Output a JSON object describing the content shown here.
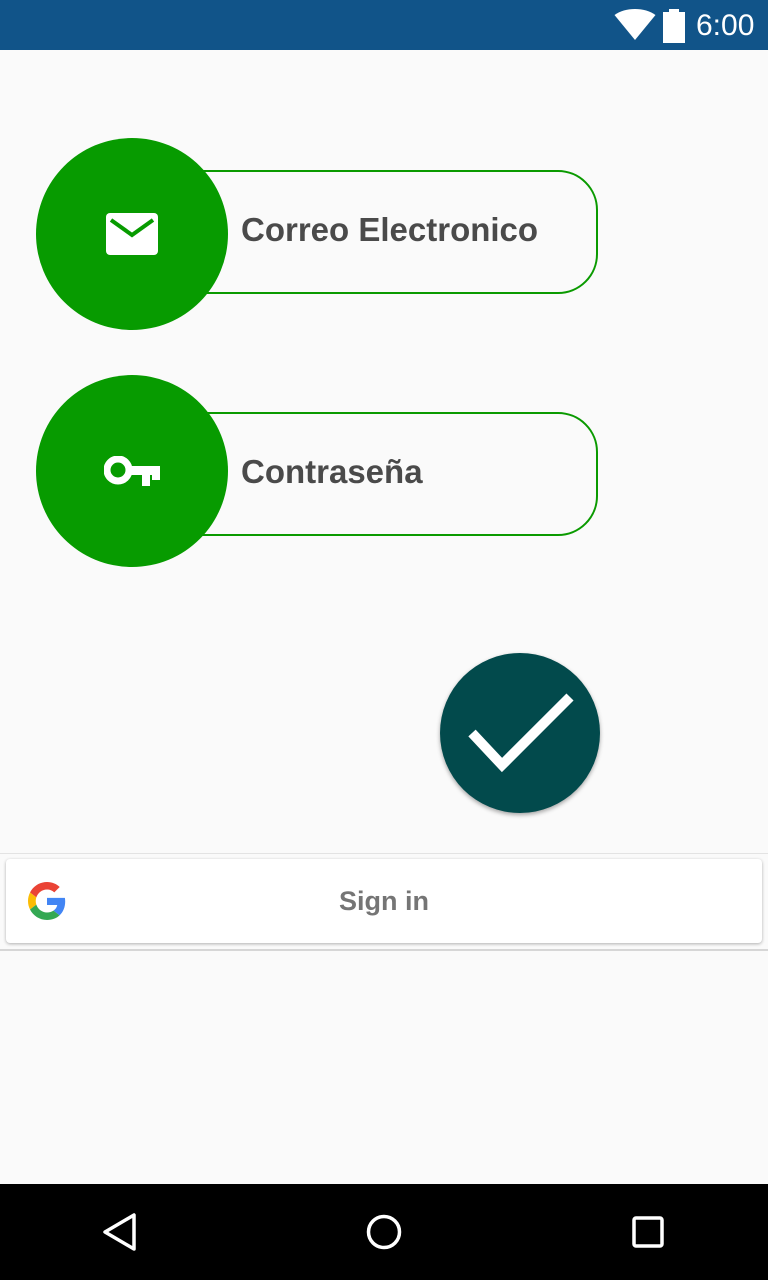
{
  "status_bar": {
    "time": "6:00",
    "background_color": "#115489",
    "icons": [
      "wifi-icon",
      "battery-icon"
    ]
  },
  "form": {
    "email": {
      "label": "Correo Electronico",
      "icon": "email-icon"
    },
    "password": {
      "label": "Contraseña",
      "icon": "key-icon"
    },
    "accent_color": "#079b00",
    "confirm_icon": "checkmark-icon",
    "confirm_color": "#024a4c"
  },
  "google_signin": {
    "label": "Sign in",
    "icon": "google-logo-icon"
  },
  "nav_bar": {
    "icons": [
      "back-icon",
      "home-icon",
      "recents-icon"
    ]
  }
}
